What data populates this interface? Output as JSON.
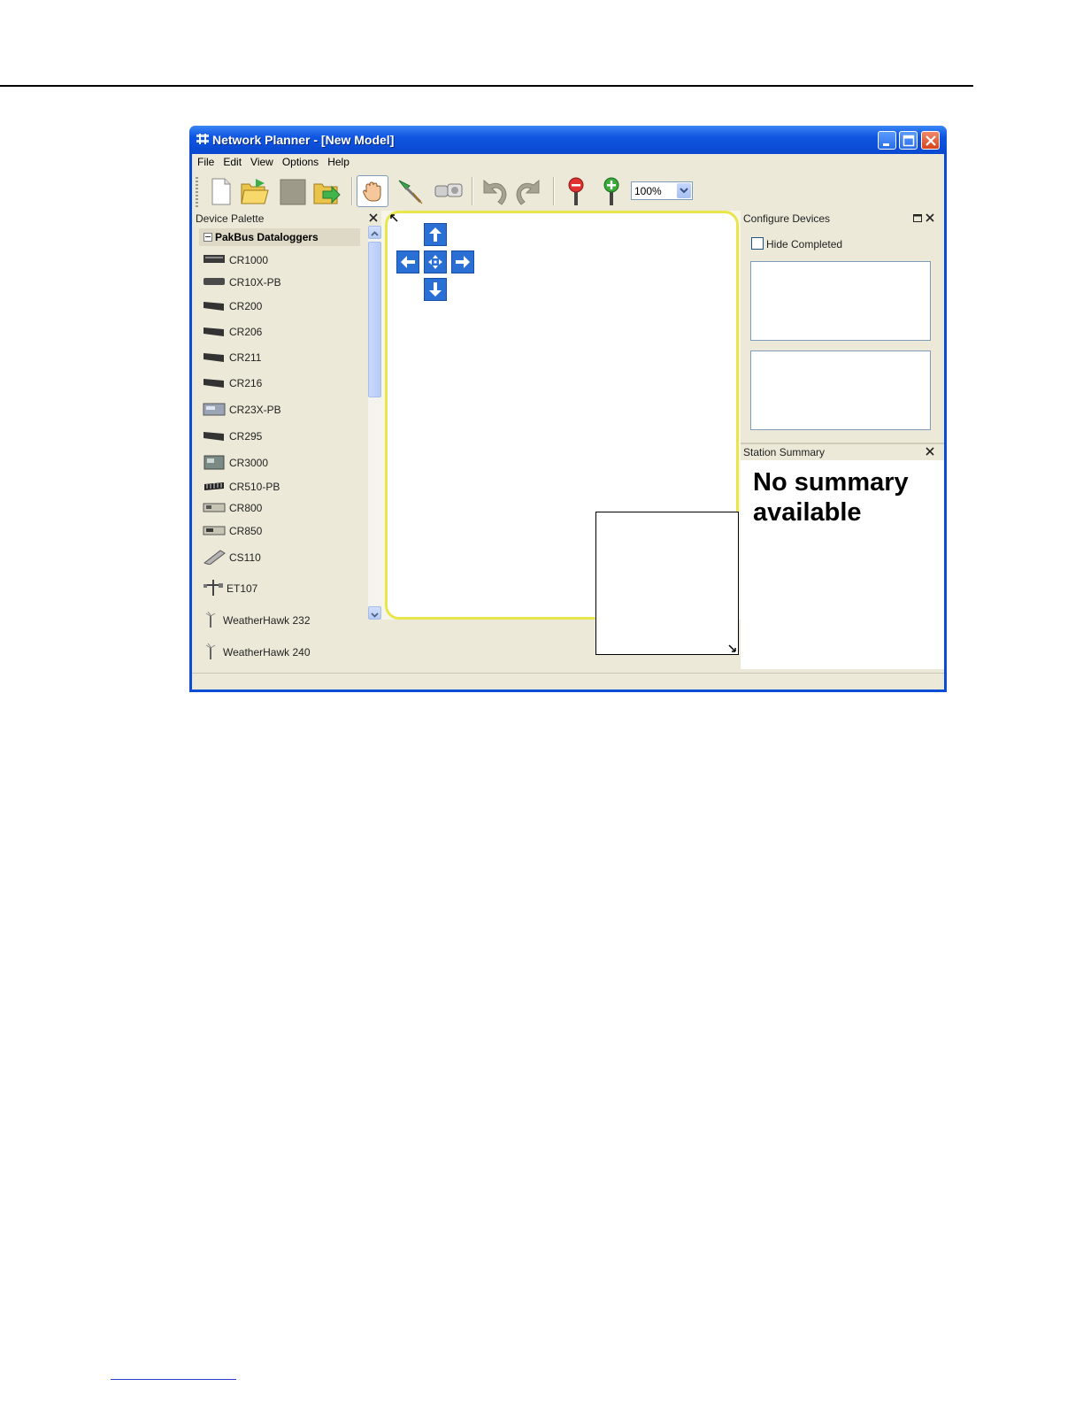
{
  "window": {
    "title": "Network Planner - [New Model]"
  },
  "menu": {
    "items": [
      "File",
      "Edit",
      "View",
      "Options",
      "Help"
    ]
  },
  "toolbar": {
    "zoom_value": "100%",
    "tools": [
      "new-file-icon",
      "open-folder-icon",
      "stop-icon",
      "export-icon",
      "hand-pan-icon",
      "link-connect-icon",
      "binoculars-icon",
      "undo-icon",
      "redo-icon",
      "zoom-out-icon",
      "zoom-in-icon"
    ]
  },
  "device_palette": {
    "title": "Device Palette",
    "group": "PakBus Dataloggers",
    "items": [
      "CR1000",
      "CR10X-PB",
      "CR200",
      "CR206",
      "CR211",
      "CR216",
      "CR23X-PB",
      "CR295",
      "CR3000",
      "CR510-PB",
      "CR800",
      "CR850",
      "CS110",
      "ET107",
      "WeatherHawk 232",
      "WeatherHawk 240"
    ]
  },
  "configure_devices": {
    "title": "Configure Devices",
    "hide_completed_label": "Hide Completed"
  },
  "station_summary": {
    "title": "Station Summary",
    "message": "No summary available"
  },
  "colors": {
    "titlebar_blue": "#0a4cd6",
    "canvas_highlight": "#e8e64a",
    "nav_arrow_blue": "#2a6fd4",
    "chrome_beige": "#ece9d8"
  }
}
